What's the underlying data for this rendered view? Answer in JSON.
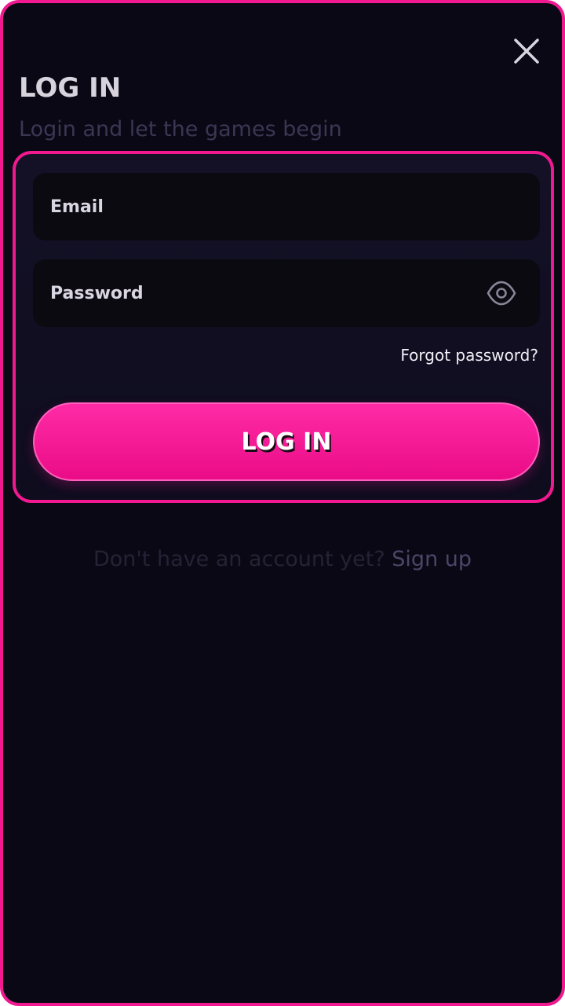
{
  "header": {
    "title": "LOG IN",
    "subtitle": "Login and let the games begin",
    "close_icon": "close-icon"
  },
  "form": {
    "email": {
      "placeholder": "Email",
      "value": ""
    },
    "password": {
      "placeholder": "Password",
      "value": "",
      "toggle_icon": "eye-icon"
    },
    "forgot_password_label": "Forgot password?",
    "submit_label": "LOG IN"
  },
  "footer": {
    "prompt": "Don't have an account yet?",
    "signup_label": "Sign up"
  },
  "colors": {
    "accent": "#f0198f",
    "background": "#0a0814",
    "card": "#141127",
    "field": "#0b0a11"
  }
}
